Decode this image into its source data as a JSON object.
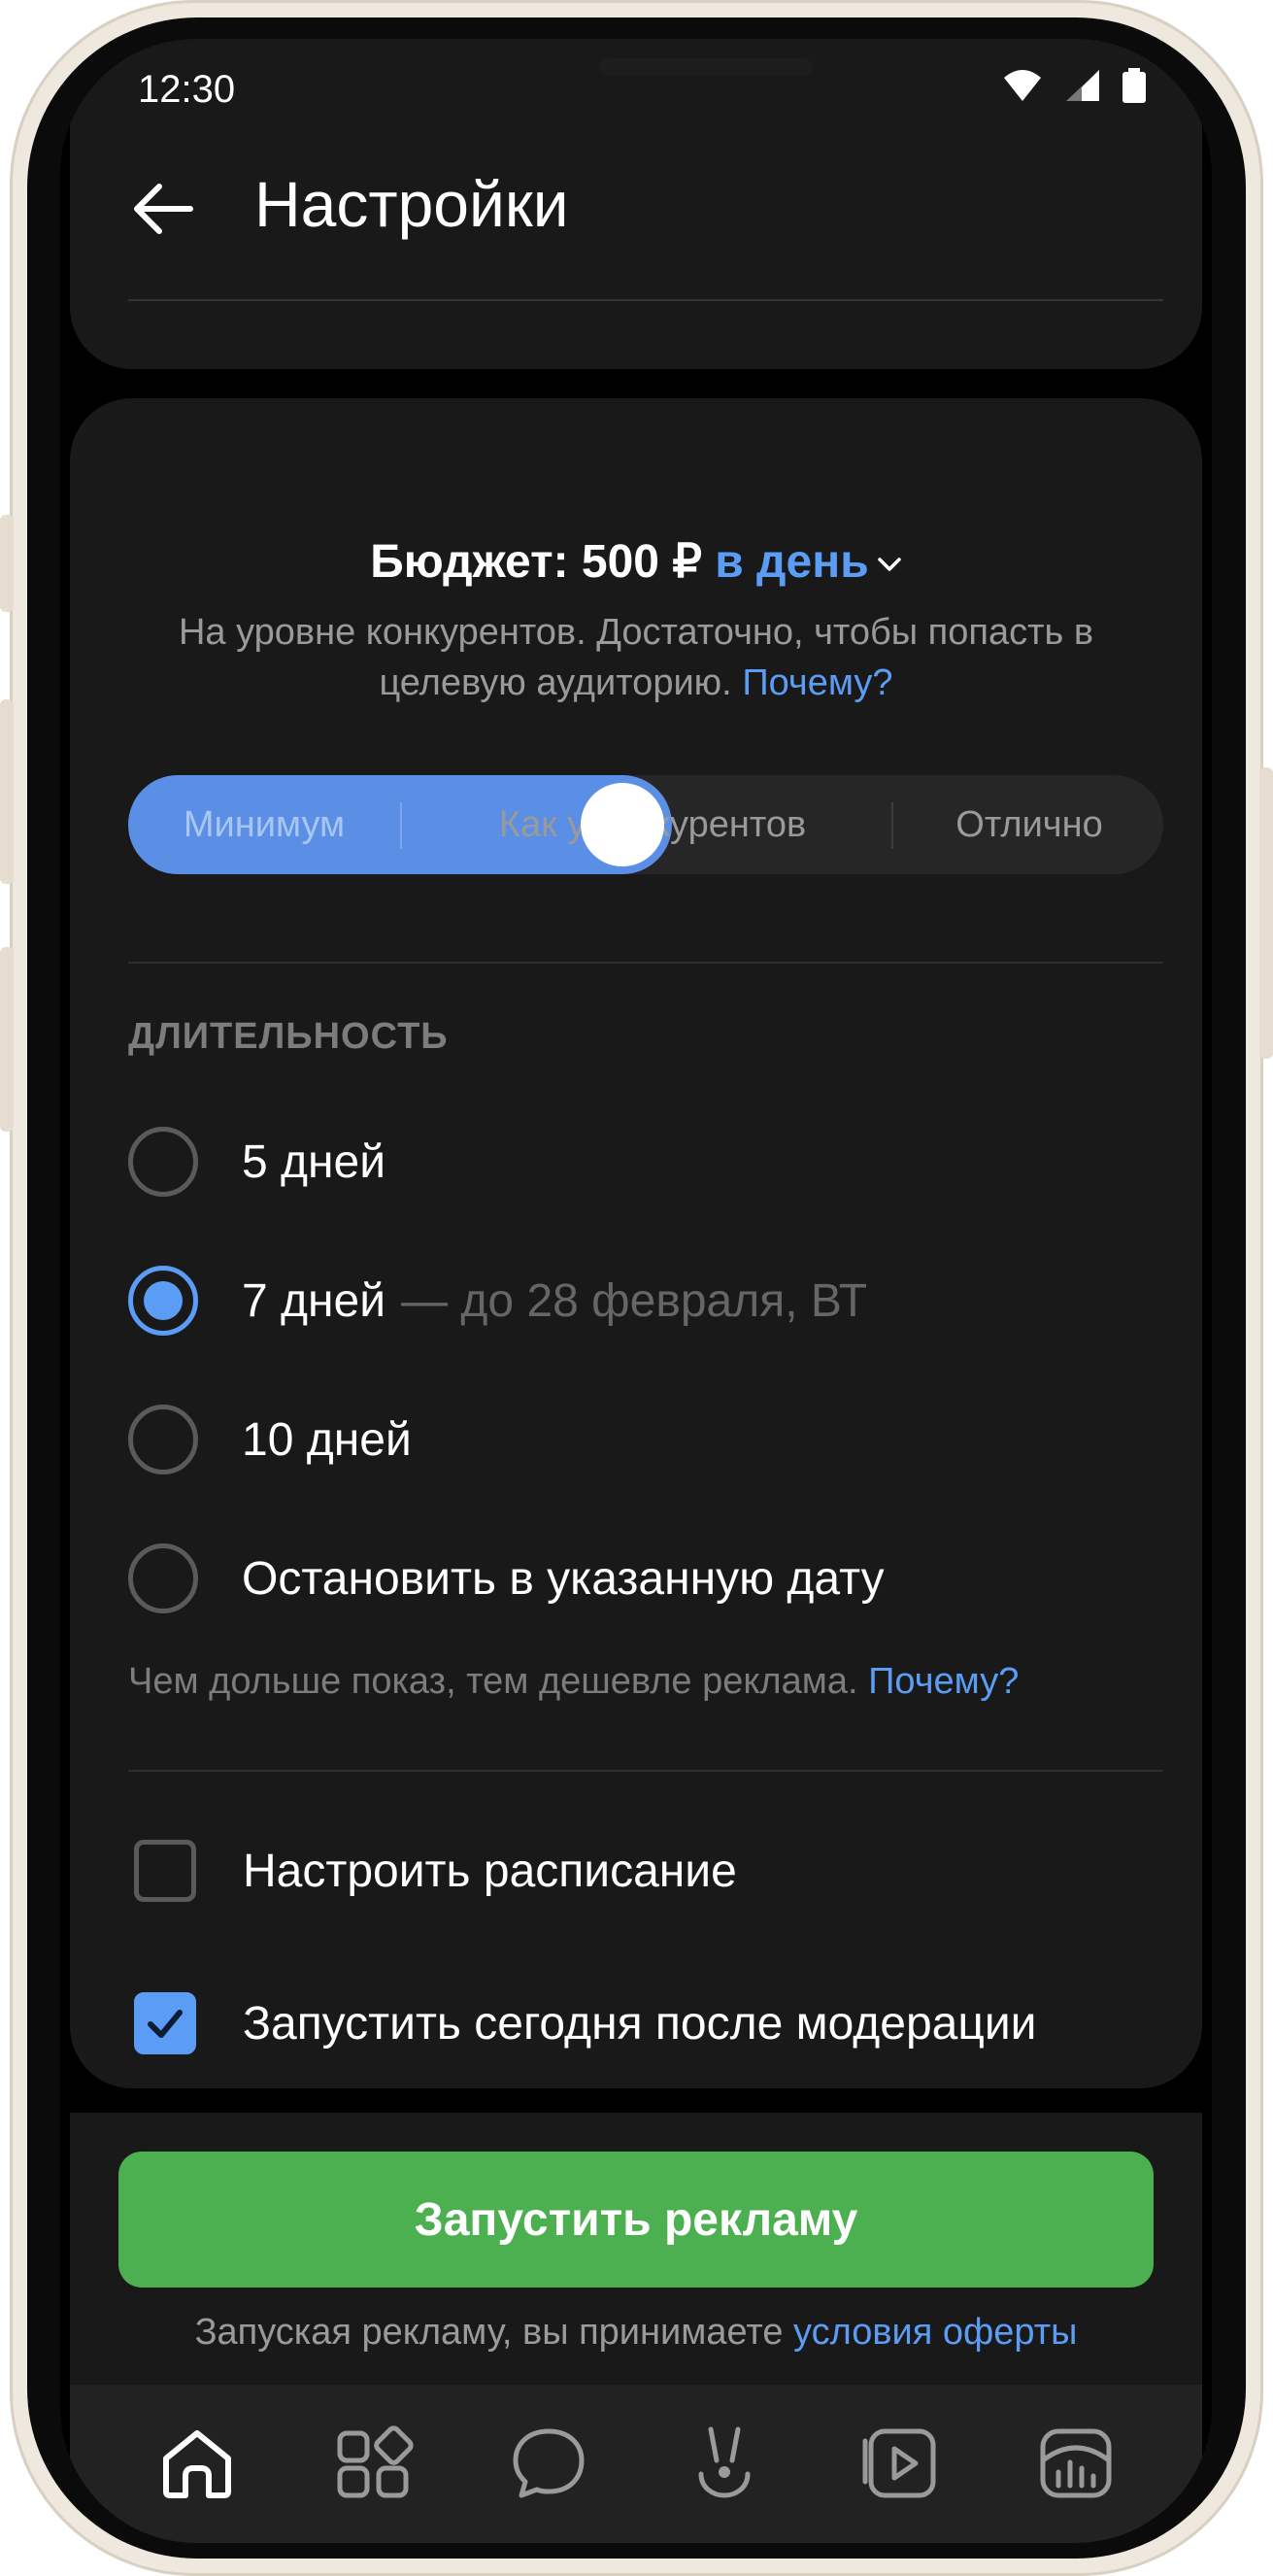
{
  "status_bar": {
    "time": "12:30"
  },
  "header": {
    "title": "Настройки",
    "back_icon": "back-arrow-icon"
  },
  "budget": {
    "label": "Бюджет: 500 ₽",
    "period": "в день",
    "description": "На уровне конкурентов. Достаточно, чтобы попасть в целевую аудиторию.",
    "why_link": "Почему?",
    "slider": {
      "options": [
        "Минимум",
        "Как у конкурентов",
        "Отлично"
      ],
      "selected": "Как у конкурентов"
    }
  },
  "duration": {
    "section_title": "ДЛИТЕЛЬНОСТЬ",
    "options": [
      {
        "label": "5 дней",
        "sub": "",
        "checked": false
      },
      {
        "label": "7 дней",
        "sub": "— до 28 февраля, ВТ",
        "checked": true
      },
      {
        "label": "10 дней",
        "sub": "",
        "checked": false
      },
      {
        "label": "Остановить в указанную дату",
        "sub": "",
        "checked": false
      }
    ],
    "hint": "Чем дольше показ, тем дешевле реклама.",
    "hint_link": "Почему?"
  },
  "options": {
    "schedule": {
      "label": "Настроить расписание",
      "checked": false
    },
    "start_today": {
      "label": "Запустить сегодня после модерации",
      "checked": true
    }
  },
  "cta": {
    "button": "Запустить рекламу",
    "note": "Запуская рекламу, вы принимаете",
    "note_link": "условия оферты"
  },
  "tabbar": {
    "items": [
      "home-icon",
      "services-icon",
      "messages-icon",
      "clips-icon",
      "video-icon",
      "stats-icon"
    ]
  },
  "colors": {
    "accent": "#5b9cf5",
    "cta": "#4caf50",
    "surface": "#191919"
  }
}
